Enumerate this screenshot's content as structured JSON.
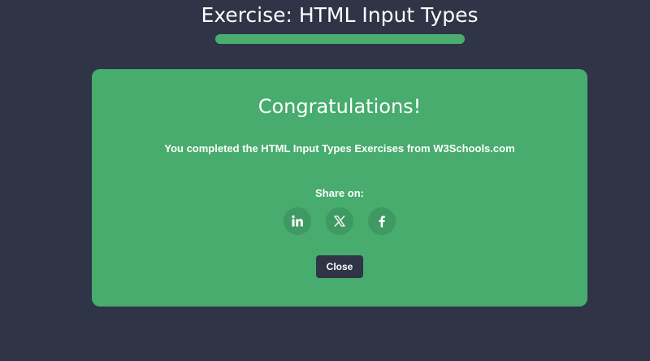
{
  "header": {
    "title": "Exercise: HTML Input Types",
    "progress": 1.0
  },
  "modal": {
    "heading": "Congratulations!",
    "message": "You completed the HTML Input Types Exercises from W3Schools.com",
    "share_label": "Share on:",
    "share_buttons": [
      {
        "icon": "linkedin-icon"
      },
      {
        "icon": "x-icon"
      },
      {
        "icon": "facebook-icon"
      }
    ],
    "close_label": "Close"
  },
  "colors": {
    "background": "#2f3447",
    "accent": "#47ac6d",
    "icon_circle": "#3f9962",
    "text": "#ffffff"
  }
}
